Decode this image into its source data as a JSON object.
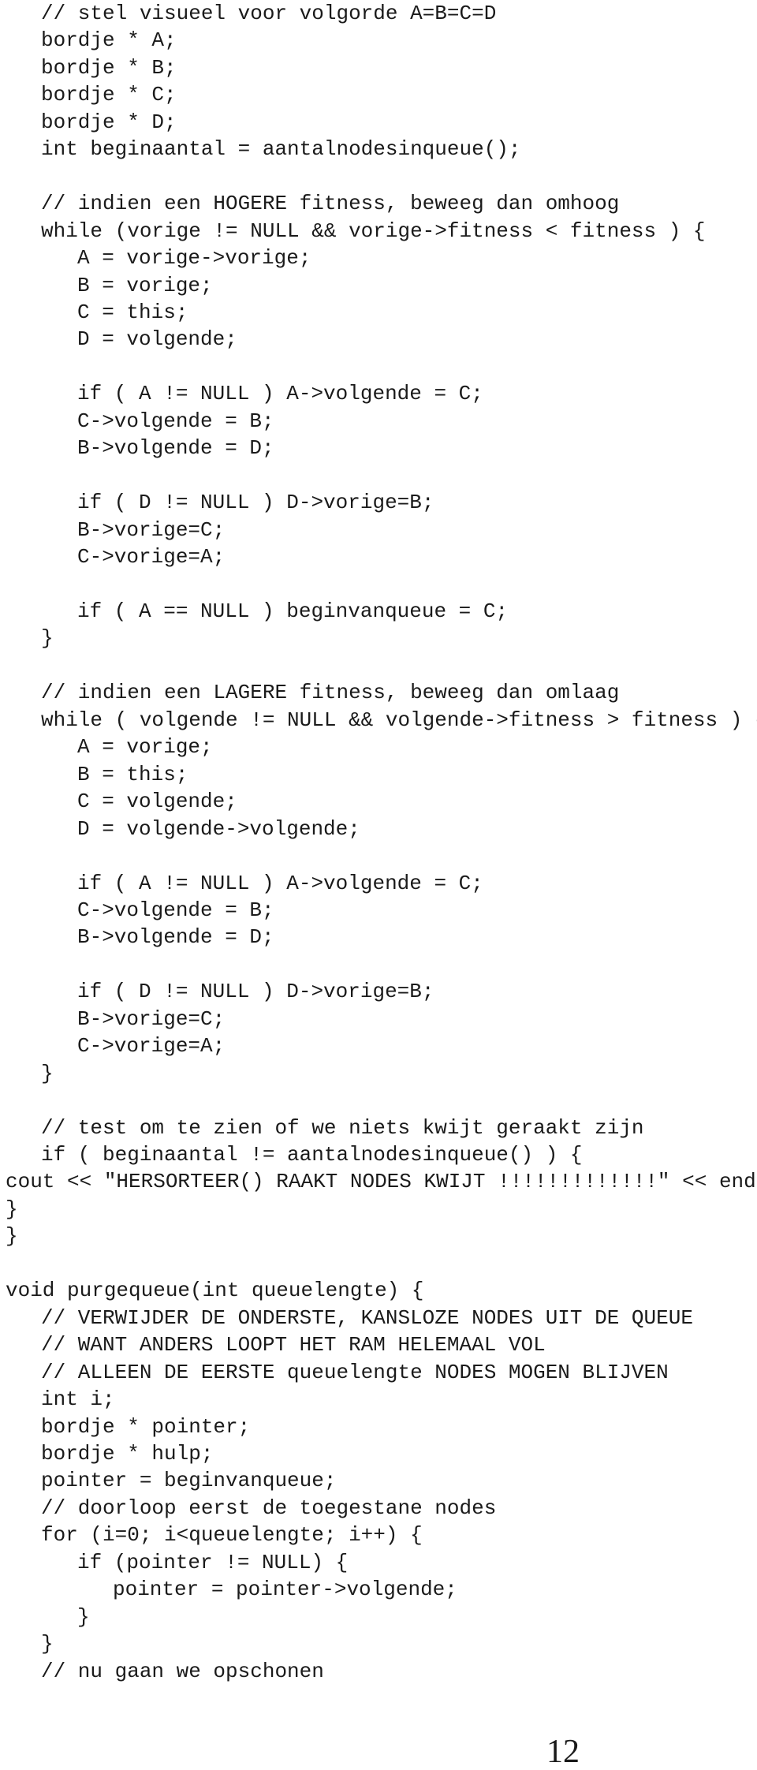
{
  "code_lines": [
    {
      "level": 1,
      "text": "// stel visueel voor volgorde A=B=C=D"
    },
    {
      "level": 1,
      "text": "bordje * A;"
    },
    {
      "level": 1,
      "text": "bordje * B;"
    },
    {
      "level": 1,
      "text": "bordje * C;"
    },
    {
      "level": 1,
      "text": "bordje * D;"
    },
    {
      "level": 1,
      "text": "int beginaantal = aantalnodesinqueue();"
    },
    {
      "level": 1,
      "text": ""
    },
    {
      "level": 1,
      "text": "// indien een HOGERE fitness, beweeg dan omhoog"
    },
    {
      "level": 1,
      "text": "while (vorige != NULL && vorige->fitness < fitness ) {"
    },
    {
      "level": 2,
      "text": "A = vorige->vorige;"
    },
    {
      "level": 2,
      "text": "B = vorige;"
    },
    {
      "level": 2,
      "text": "C = this;"
    },
    {
      "level": 2,
      "text": "D = volgende;"
    },
    {
      "level": 2,
      "text": ""
    },
    {
      "level": 2,
      "text": "if ( A != NULL ) A->volgende = C;"
    },
    {
      "level": 2,
      "text": "C->volgende = B;"
    },
    {
      "level": 2,
      "text": "B->volgende = D;"
    },
    {
      "level": 2,
      "text": ""
    },
    {
      "level": 2,
      "text": "if ( D != NULL ) D->vorige=B;"
    },
    {
      "level": 2,
      "text": "B->vorige=C;"
    },
    {
      "level": 2,
      "text": "C->vorige=A;"
    },
    {
      "level": 2,
      "text": ""
    },
    {
      "level": 2,
      "text": "if ( A == NULL ) beginvanqueue = C;"
    },
    {
      "level": 1,
      "text": "}"
    },
    {
      "level": 1,
      "text": ""
    },
    {
      "level": 1,
      "text": "// indien een LAGERE fitness, beweeg dan omlaag"
    },
    {
      "level": 1,
      "text": "while ( volgende != NULL && volgende->fitness > fitness ) {"
    },
    {
      "level": 2,
      "text": "A = vorige;"
    },
    {
      "level": 2,
      "text": "B = this;"
    },
    {
      "level": 2,
      "text": "C = volgende;"
    },
    {
      "level": 2,
      "text": "D = volgende->volgende;"
    },
    {
      "level": 2,
      "text": ""
    },
    {
      "level": 2,
      "text": "if ( A != NULL ) A->volgende = C;"
    },
    {
      "level": 2,
      "text": "C->volgende = B;"
    },
    {
      "level": 2,
      "text": "B->volgende = D;"
    },
    {
      "level": 2,
      "text": ""
    },
    {
      "level": 2,
      "text": "if ( D != NULL ) D->vorige=B;"
    },
    {
      "level": 2,
      "text": "B->vorige=C;"
    },
    {
      "level": 2,
      "text": "C->vorige=A;"
    },
    {
      "level": 1,
      "text": "}"
    },
    {
      "level": 1,
      "text": ""
    },
    {
      "level": 1,
      "text": "// test om te zien of we niets kwijt geraakt zijn"
    },
    {
      "level": 1,
      "text": "if ( beginaantal != aantalnodesinqueue() ) {"
    },
    {
      "level": 0,
      "text": "cout << \"HERSORTEER() RAAKT NODES KWIJT !!!!!!!!!!!!!\" << endl;"
    },
    {
      "level": 0,
      "text": "}"
    },
    {
      "level": 0,
      "text": "}"
    },
    {
      "level": 0,
      "text": ""
    },
    {
      "level": 0,
      "text": "void purgequeue(int queuelengte) {"
    },
    {
      "level": 1,
      "text": "// VERWIJDER DE ONDERSTE, KANSLOZE NODES UIT DE QUEUE"
    },
    {
      "level": 1,
      "text": "// WANT ANDERS LOOPT HET RAM HELEMAAL VOL"
    },
    {
      "level": 1,
      "text": "// ALLEEN DE EERSTE queuelengte NODES MOGEN BLIJVEN"
    },
    {
      "level": 1,
      "text": "int i;"
    },
    {
      "level": 1,
      "text": "bordje * pointer;"
    },
    {
      "level": 1,
      "text": "bordje * hulp;"
    },
    {
      "level": 1,
      "text": "pointer = beginvanqueue;"
    },
    {
      "level": 1,
      "text": "// doorloop eerst de toegestane nodes"
    },
    {
      "level": 1,
      "text": "for (i=0; i<queuelengte; i++) {"
    },
    {
      "level": 2,
      "text": "if (pointer != NULL) {"
    },
    {
      "level": 3,
      "text": "pointer = pointer->volgende;"
    },
    {
      "level": 2,
      "text": "}"
    },
    {
      "level": 1,
      "text": "}"
    },
    {
      "level": 1,
      "text": "// nu gaan we opschonen"
    }
  ],
  "page_number": "12"
}
